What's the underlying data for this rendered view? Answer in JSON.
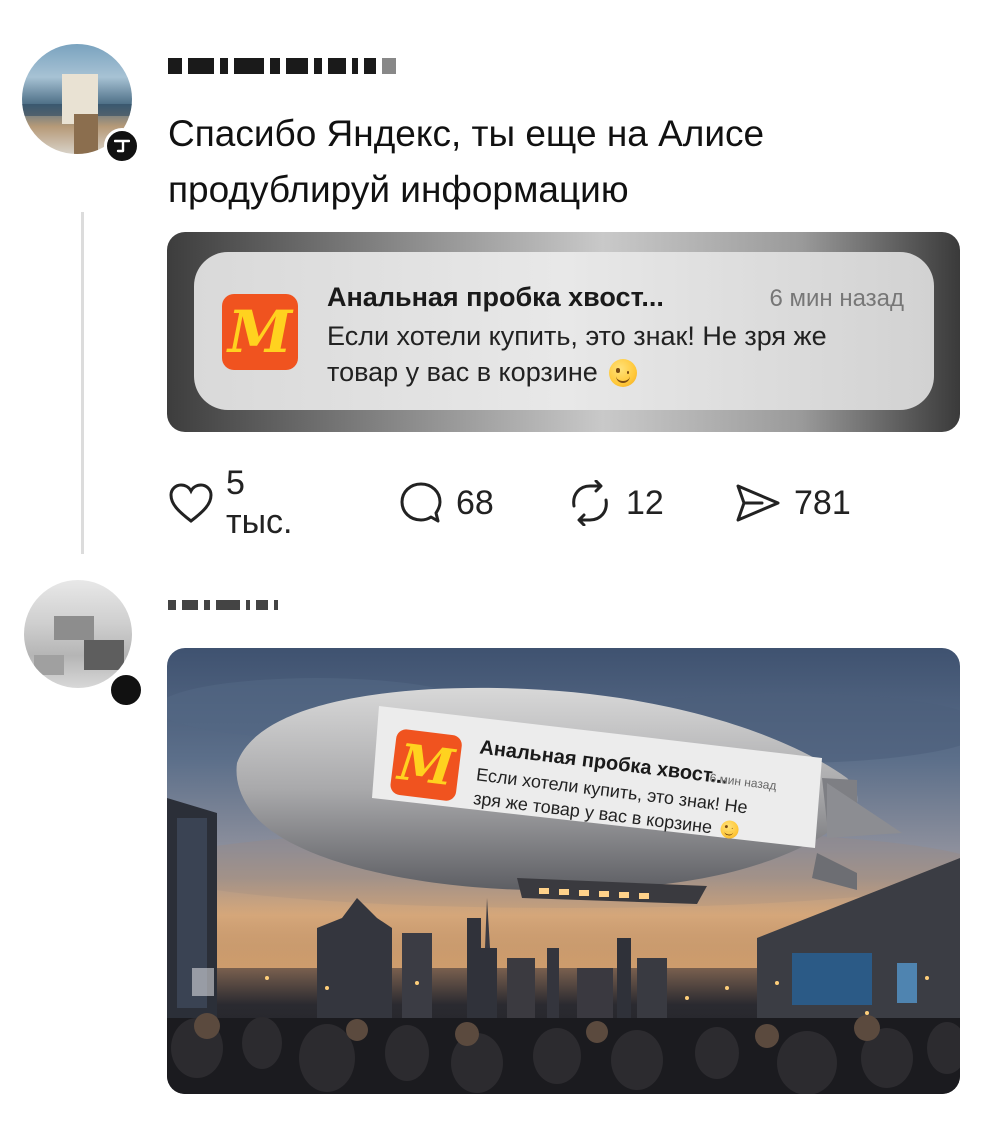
{
  "post1": {
    "text": "Спасибо Яндекс, ты еще на Алисе продублируй информацию",
    "notification": {
      "title": "Анальная пробка хвост...",
      "time": "6 мин назад",
      "body": "Если хотели купить, это знак! Не зря же товар у вас в корзине",
      "emoji": "winking-face"
    },
    "actions": {
      "likes": "5 тыс.",
      "comments": "68",
      "reposts": "12",
      "views": "781"
    }
  },
  "post2": {
    "image": {
      "sign_title": "Анальная пробка хвост...",
      "sign_time": "6 мин назад",
      "sign_body": "Если хотели купить, это знак! Не зря же товар у вас в корзине"
    }
  },
  "colors": {
    "app_icon_bg": "#f0531f",
    "app_icon_fg": "#ffd21f",
    "text": "#111111",
    "muted": "#777777"
  },
  "icons": [
    "heart-icon",
    "comment-icon",
    "repost-icon",
    "views-icon"
  ]
}
